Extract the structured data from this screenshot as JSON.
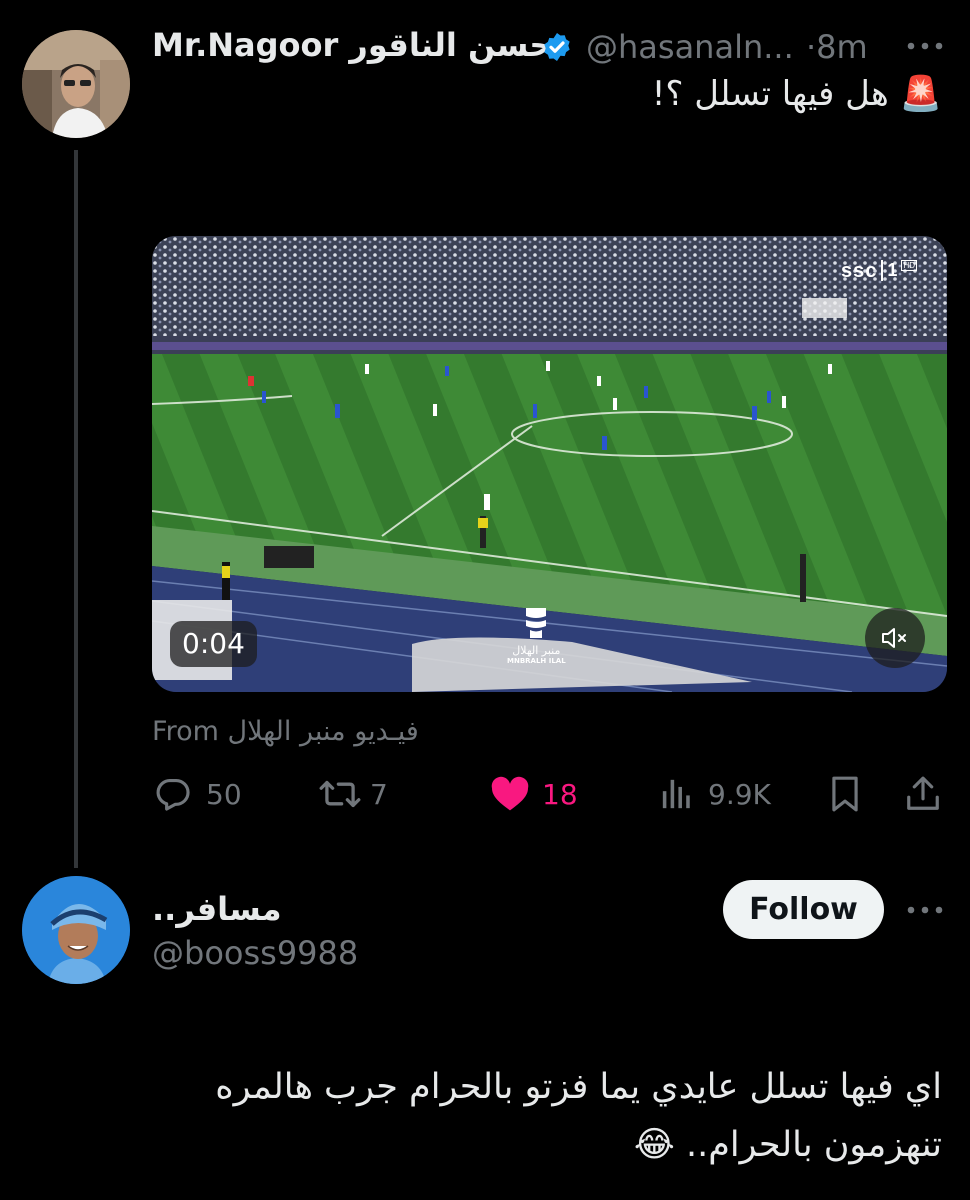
{
  "tweet": {
    "display_name": "Mr.Nagoor حسن الناقور",
    "handle": "@hasanaln...",
    "time": "·8m",
    "text_emoji": "🚨",
    "text": "هل فيها تسلل ؟!",
    "video": {
      "duration": "0:04",
      "channel_logo": "ssc",
      "channel_number": "1",
      "channel_hd": "HD",
      "watermark_name": "منبر الهلال",
      "watermark_sub": "MNBRALH ILAL"
    },
    "source": "From فيـديو منبر الهلال",
    "actions": {
      "replies": "50",
      "reposts": "7",
      "likes": "18",
      "views": "9.9K"
    },
    "colors": {
      "like": "#f91880",
      "verified": "#1d9bf0",
      "muted": "#71767b"
    }
  },
  "reply": {
    "display_name": "مسافر..",
    "handle": "@booss9988",
    "follow_label": "Follow",
    "text_line1": "اي فيها تسلل عايدي يما فزتو بالحرام جرب هالمره",
    "text_line2": "تنهزمون بالحرام..",
    "emoji": "😂"
  },
  "icons": [
    "verified-badge-icon",
    "more-icon",
    "reply-icon",
    "repost-icon",
    "like-icon",
    "views-icon",
    "bookmark-icon",
    "share-icon",
    "mute-icon"
  ]
}
